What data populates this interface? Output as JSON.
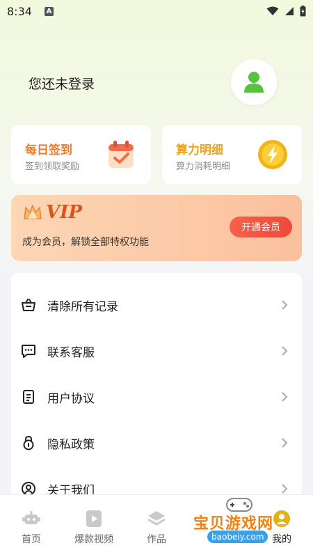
{
  "status_bar": {
    "time": "8:34",
    "notification_letter": "A"
  },
  "profile": {
    "login_text": "您还未登录"
  },
  "cards": {
    "checkin": {
      "title": "每日签到",
      "subtitle": "签到领取奖励",
      "title_color": "#f27a2a"
    },
    "power": {
      "title": "算力明细",
      "subtitle": "算力消耗明细",
      "title_color": "#f0a31a"
    }
  },
  "vip": {
    "logo_text": "VIP",
    "subtitle": "成为会员，解锁全部特权功能",
    "button_label": "开通会员"
  },
  "menu": {
    "items": [
      {
        "label": "清除所有记录",
        "icon": "basket-icon"
      },
      {
        "label": "联系客服",
        "icon": "chat-icon"
      },
      {
        "label": "用户协议",
        "icon": "document-icon"
      },
      {
        "label": "隐私政策",
        "icon": "lock-icon"
      },
      {
        "label": "关于我们",
        "icon": "user-circle-icon"
      }
    ]
  },
  "tabbar": {
    "tabs": [
      {
        "label": "首页",
        "icon": "robot-icon"
      },
      {
        "label": "爆款视频",
        "icon": "video-icon"
      },
      {
        "label": "作品",
        "icon": "layers-icon"
      },
      {
        "label": "我的",
        "icon": "profile-icon"
      }
    ]
  },
  "watermark": {
    "text": "宝贝游戏网",
    "url": "baobeiy.com"
  }
}
